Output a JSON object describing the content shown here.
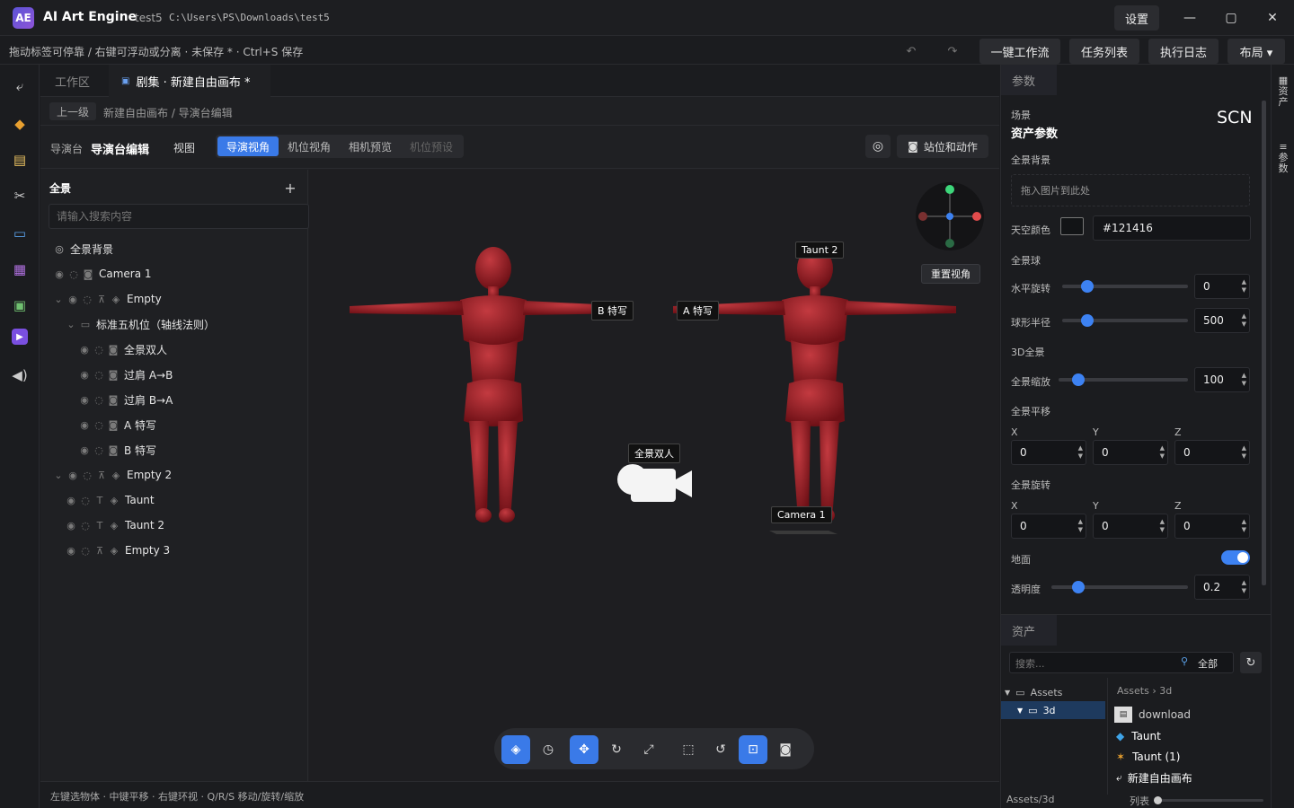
{
  "window": {
    "logo": "AE",
    "title": "AI Art Engine",
    "project": "test5",
    "path": "C:\\Users\\PS\\Downloads\\test5",
    "settings": "设置",
    "minimize": "—",
    "maximize": "▢",
    "close": "✕"
  },
  "toolbar": {
    "hint": "拖动标签可停靠 / 右键可浮动或分离 · 未保存 * · Ctrl+S 保存",
    "undo": "↶",
    "redo": "↷",
    "buttons": [
      "一键工作流",
      "任务列表",
      "执行日志",
      "布局 ▾"
    ]
  },
  "tabs": {
    "workspace": "工作区",
    "active": "剧集 · 新建自由画布 *"
  },
  "breadcrumb": {
    "up": "上一级",
    "path": "新建自由画布 / 导演台编辑"
  },
  "modebar": {
    "prefix": "导演台",
    "title": "导演台编辑",
    "view": "视图",
    "modes": [
      "导演视角",
      "机位视角",
      "相机预览",
      "机位预设"
    ],
    "pose_button": "站位和动作"
  },
  "tree": {
    "title": "全景",
    "add": "+",
    "search_placeholder": "请输入搜索内容",
    "root": "全景背景",
    "items": [
      "Camera 1",
      "Empty",
      "标准五机位（轴线法则）",
      "全景双人",
      "过肩 A→B",
      "过肩 B→A",
      "A 特写",
      "B 特写",
      "Empty 2",
      "Taunt",
      "Taunt 2",
      "Empty 3"
    ]
  },
  "viewport": {
    "labels": [
      "B 特写",
      "A 特写",
      "Taunt 2",
      "全景双人",
      "Camera 1"
    ],
    "reset_view": "重置视角",
    "figure_color": "#9e1f26"
  },
  "status": "左键选物体 · 中键平移 · 右键环视 · Q/R/S 移动/旋转/缩放",
  "params": {
    "tab": "参数",
    "scene_label": "场景",
    "scene_title": "资产参数",
    "scn": "SCN",
    "bg_label": "全景背景",
    "bg_drop": "拖入图片到此处",
    "sky_label": "天空颜色",
    "sky_value": "#121416",
    "sphere_label": "全景球",
    "h_rot_label": "水平旋转",
    "h_rot_value": "0",
    "h_rot_fraction": 0.2,
    "radius_label": "球形半径",
    "radius_value": "500",
    "radius_fraction": 0.2,
    "p3d_label": "3D全景",
    "scale_label": "全景缩放",
    "scale_value": "100",
    "scale_fraction": 0.15,
    "pan_label": "全景平移",
    "rot_label": "全景旋转",
    "x": "X",
    "y": "Y",
    "z": "Z",
    "pan": [
      "0",
      "0",
      "0"
    ],
    "rot": [
      "0",
      "0",
      "0"
    ],
    "ground_label": "地面",
    "ground_on": true,
    "opacity_label": "透明度",
    "opacity_value": "0.2",
    "opacity_fraction": 0.2
  },
  "assets": {
    "tab": "资产",
    "search_placeholder": "搜索...",
    "filter": "全部",
    "tree": [
      "Assets",
      "3d"
    ],
    "crumb": [
      "Assets",
      "›",
      "3d"
    ],
    "files": [
      "download",
      "Taunt",
      "Taunt (1)",
      "新建自由画布"
    ],
    "footer_path": "Assets/3d",
    "view_mode": "列表"
  },
  "side_tabs": [
    "资产",
    "参数"
  ]
}
